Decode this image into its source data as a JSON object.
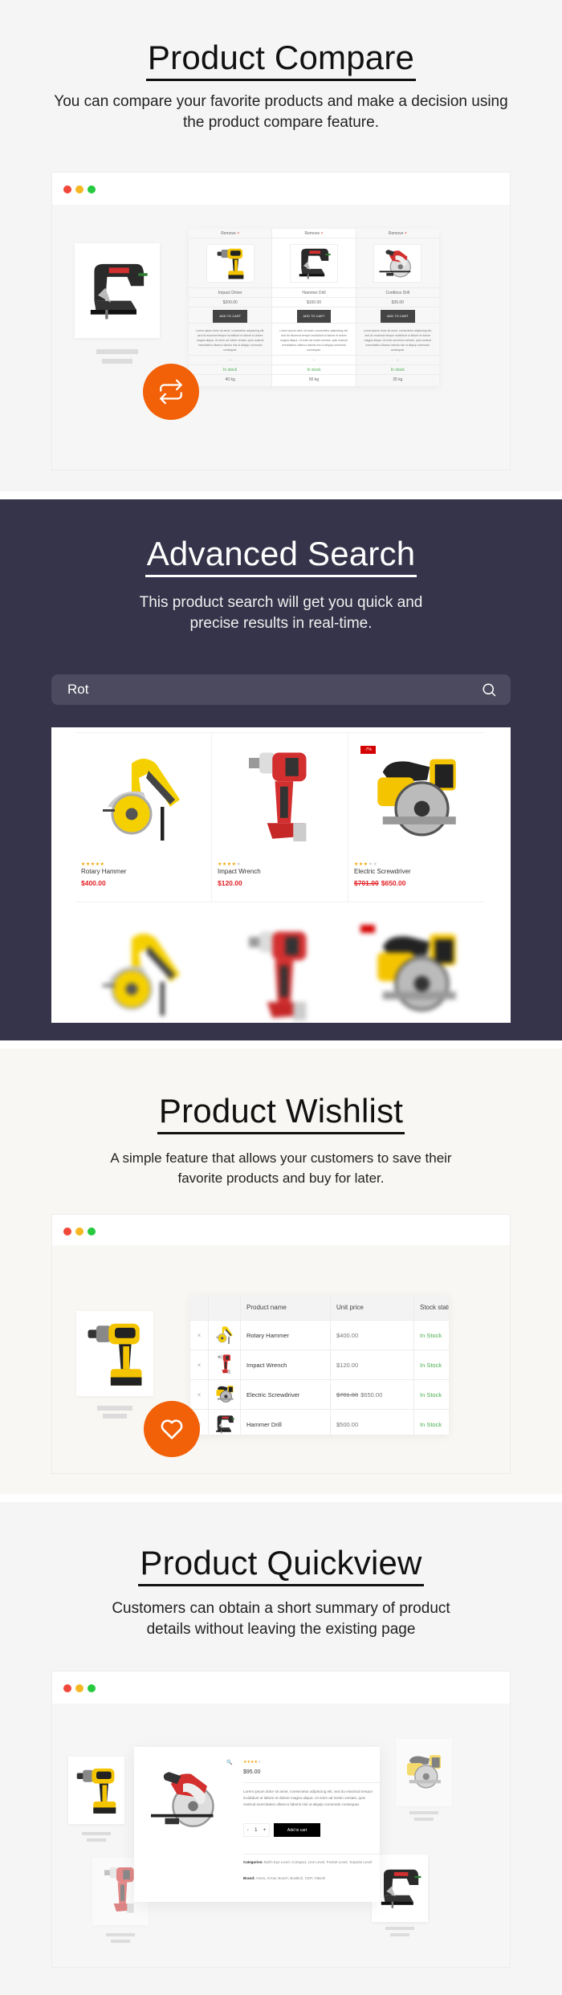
{
  "colors": {
    "accent": "#f26008",
    "sale_red": "#e31e24",
    "stock_green": "#4caf50",
    "star": "#f5a300",
    "dark_bg": "#36344a"
  },
  "compare": {
    "title": "Product Compare",
    "subtitle": "You can compare your favorite products and make a decision using the product compare feature.",
    "fab_icon": "compare-arrows-icon",
    "columns": [
      {
        "remove": "Remove",
        "name": "Impact Driver",
        "price": "$200.00",
        "button": "ADD TO CART",
        "description": "Lorem ipsum dolor sit amet, consectetur adipiscing elit, sed do eiusmod tempor incididunt ut labore et dolore magna aliqua. Ut enim ad minim veniam, quis nostrud exercitation ullamco laboris nisi ut aliquip commodo consequat.",
        "dash": "-",
        "stock": "In stock",
        "weight": "40 kg"
      },
      {
        "remove": "Remove",
        "name": "Hammer Drill",
        "price": "$100.00",
        "button": "ADD TO CART",
        "description": "Lorem ipsum dolor sit amet, consectetur adipiscing elit, sed do eiusmod tempor incididunt ut labore et dolore magna aliqua. Ut enim ad minim veniam, quis nostrud exercitation ullamco laboris nisi ut aliquip commodo consequat.",
        "dash": "-",
        "stock": "In stock",
        "weight": "50 kg"
      },
      {
        "remove": "Remove",
        "name": "Cordless Drill",
        "price": "$35.00",
        "button": "ADD TO CART",
        "description": "Lorem ipsum dolor sit amet, consectetur adipiscing elit, sed do eiusmod tempor incididunt ut labore et dolore magna aliqua. Ut enim ad minim veniam, quis nostrud exercitation ullamco laboris nisi ut aliquip commodo consequat.",
        "dash": "-",
        "stock": "In stock",
        "weight": "35 kg"
      }
    ]
  },
  "search": {
    "title": "Advanced Search",
    "subtitle": "This product search will get you quick and precise results in real-time.",
    "query": "Rot",
    "results": [
      {
        "name": "Rotary Hammer",
        "price": "$400.00",
        "old_price": "",
        "rating": 5,
        "badge": ""
      },
      {
        "name": "Impact Wrench",
        "price": "$120.00",
        "old_price": "",
        "rating": 4,
        "badge": ""
      },
      {
        "name": "Electric Screwdriver",
        "price": "$650.00",
        "old_price": "$701.00",
        "rating": 3,
        "badge": "-7%"
      }
    ]
  },
  "wishlist": {
    "title": "Product Wishlist",
    "subtitle": "A simple feature that allows your customers to save their favorite products and buy for later.",
    "fab_icon": "heart-icon",
    "headers": [
      "",
      "",
      "Product name",
      "Unit price",
      "Stock status"
    ],
    "rows": [
      {
        "remove": "×",
        "name": "Rotary Hammer",
        "price": "$400.00",
        "old_price": "",
        "stock": "In Stock"
      },
      {
        "remove": "×",
        "name": "Impact Wrench",
        "price": "$120.00",
        "old_price": "",
        "stock": "In Stock"
      },
      {
        "remove": "×",
        "name": "Electric Screwdriver",
        "price": "$650.00",
        "old_price": "$701.00",
        "stock": "In Stock"
      },
      {
        "remove": "×",
        "name": "Hammer Drill",
        "price": "$500.00",
        "old_price": "",
        "stock": "In Stock"
      }
    ]
  },
  "quickview": {
    "title": "Product Quickview",
    "subtitle": "Customers can obtain a short summary of product details without leaving the existing page",
    "rating": 4,
    "price": "$95.00",
    "description": "Lorem ipsum dolor sit amet, consectetur adipiscing elit, sed do eiusmod tempor incididunt ut labore et dolore magna aliqua. Ut enim ad minim veniam, quis nostrud exercitation ullamco laboris nisi ut aliquip commodo consequat.",
    "qty_minus": "-",
    "qty": "1",
    "qty_plus": "+",
    "add_to_cart": "Add to cart",
    "categories_label": "Categories:",
    "categories": "Bull's Eye Level, Compact, Line Level, Pocket Level, Torpedo Level",
    "brand_label": "Brand:",
    "brand": "Ames, Arrow, Bosch, Bostitch, CMT, Hitachi"
  }
}
